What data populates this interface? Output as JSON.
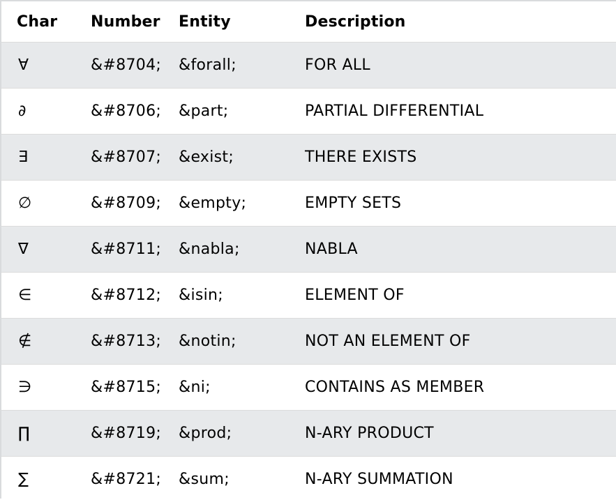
{
  "table": {
    "headers": {
      "char": "Char",
      "number": "Number",
      "entity": "Entity",
      "description": "Description"
    },
    "rows": [
      {
        "char": "∀",
        "number": "&#8704;",
        "entity": "&forall;",
        "description": "FOR ALL"
      },
      {
        "char": "∂",
        "number": "&#8706;",
        "entity": "&part;",
        "description": "PARTIAL DIFFERENTIAL"
      },
      {
        "char": "∃",
        "number": "&#8707;",
        "entity": "&exist;",
        "description": "THERE EXISTS"
      },
      {
        "char": "∅",
        "number": "&#8709;",
        "entity": "&empty;",
        "description": "EMPTY SETS"
      },
      {
        "char": "∇",
        "number": "&#8711;",
        "entity": "&nabla;",
        "description": "NABLA"
      },
      {
        "char": "∈",
        "number": "&#8712;",
        "entity": "&isin;",
        "description": "ELEMENT OF"
      },
      {
        "char": "∉",
        "number": "&#8713;",
        "entity": "&notin;",
        "description": "NOT AN ELEMENT OF"
      },
      {
        "char": "∋",
        "number": "&#8715;",
        "entity": "&ni;",
        "description": "CONTAINS AS MEMBER"
      },
      {
        "char": "∏",
        "number": "&#8719;",
        "entity": "&prod;",
        "description": "N-ARY PRODUCT"
      },
      {
        "char": "∑",
        "number": "&#8721;",
        "entity": "&sum;",
        "description": "N-ARY SUMMATION"
      }
    ]
  }
}
